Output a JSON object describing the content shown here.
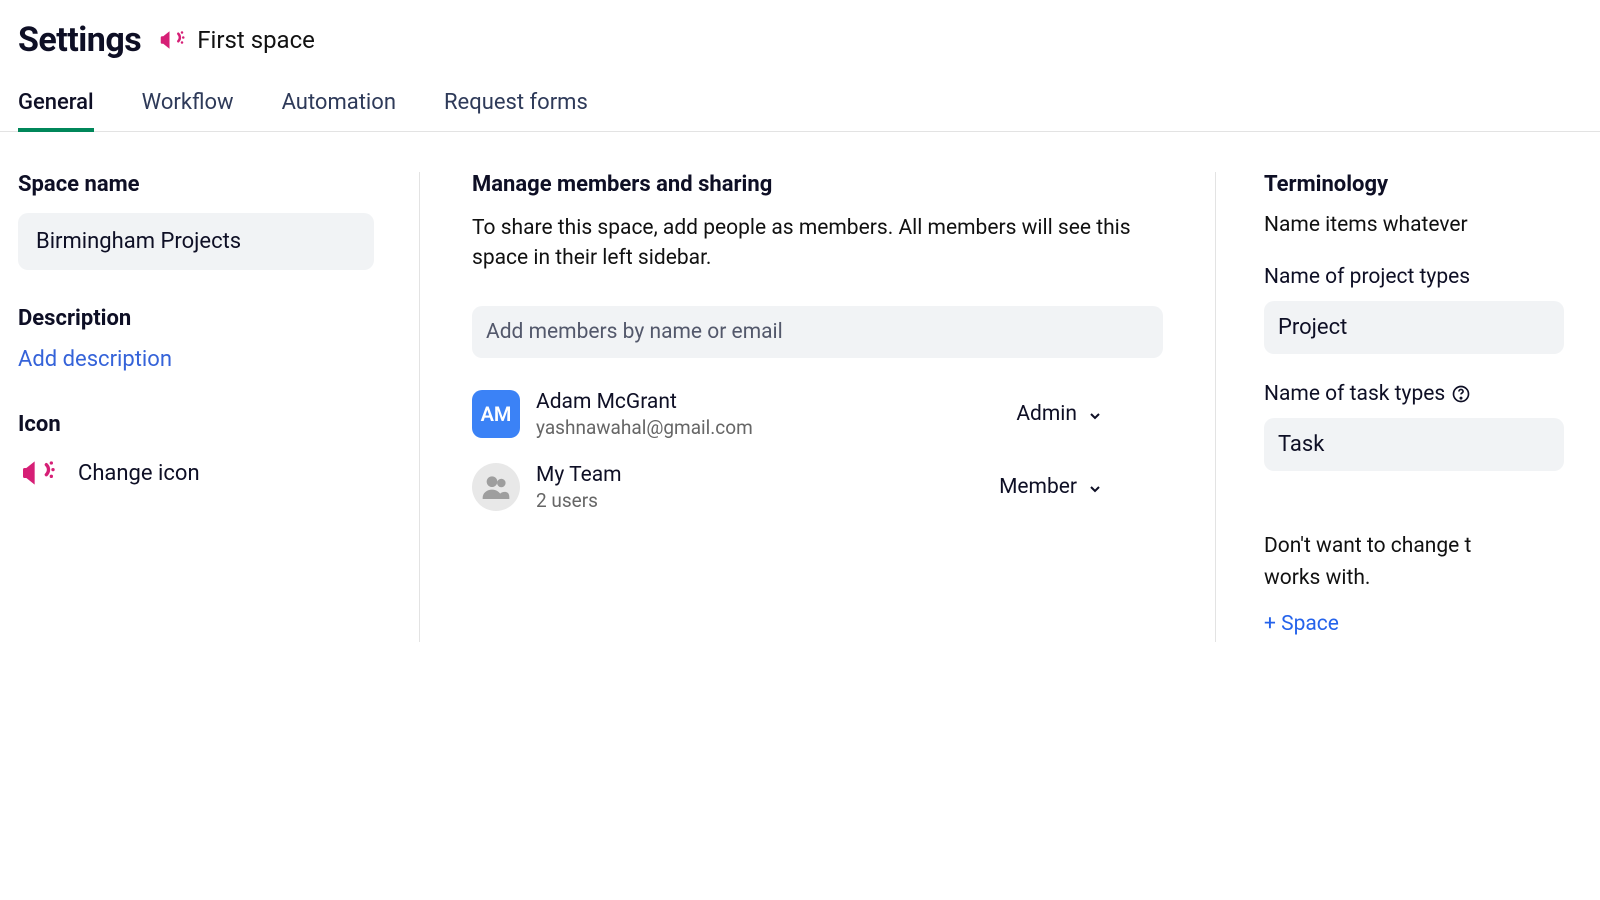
{
  "header": {
    "title": "Settings",
    "space_name": "First space"
  },
  "tabs": [
    {
      "label": "General",
      "active": true
    },
    {
      "label": "Workflow",
      "active": false
    },
    {
      "label": "Automation",
      "active": false
    },
    {
      "label": "Request forms",
      "active": false
    }
  ],
  "left": {
    "space_name_label": "Space name",
    "space_name_value": "Birmingham Projects",
    "description_label": "Description",
    "add_description_link": "Add description",
    "icon_label": "Icon",
    "change_icon_label": "Change icon"
  },
  "mid": {
    "heading": "Manage members and sharing",
    "description": "To share this space, add people as members. All members will see this space in their left sidebar.",
    "add_member_placeholder": "Add members by name or email",
    "members": [
      {
        "initials": "AM",
        "name": "Adam McGrant",
        "sub": "yashnawahal@gmail.com",
        "role": "Admin",
        "type": "user"
      },
      {
        "name": "My Team",
        "sub": "2 users",
        "role": "Member",
        "type": "team"
      }
    ]
  },
  "right": {
    "heading": "Terminology",
    "description": "Name items whatever",
    "project_types_label": "Name of project types",
    "project_type_value": "Project",
    "task_types_label": "Name of task types",
    "task_type_value": "Task",
    "hint_line1": "Don't want to change t",
    "hint_line2": "works with.",
    "add_space_link": "+ Space"
  }
}
